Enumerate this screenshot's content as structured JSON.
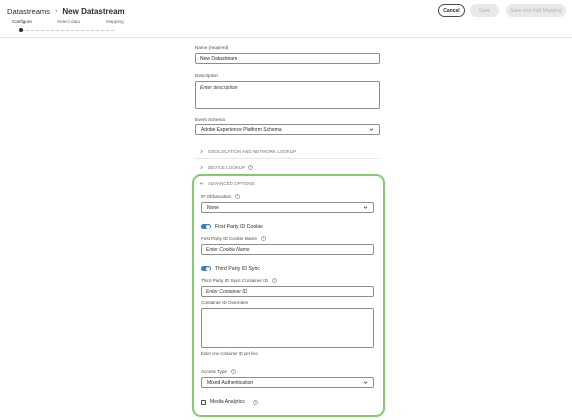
{
  "header": {
    "breadcrumb_root": "Datastreams",
    "breadcrumb_separator": "›",
    "breadcrumb_current": "New Datastream",
    "cancel_label": "Cancel",
    "save_label": "Save",
    "save_and_add_mapping_label": "Save and Add Mapping"
  },
  "steps": {
    "items": [
      {
        "label": "Configure",
        "active": true
      },
      {
        "label": "Select data",
        "active": false
      },
      {
        "label": "Mapping",
        "active": false
      }
    ]
  },
  "form": {
    "name_label": "Name (required)",
    "name_value": "New Datastream",
    "description_label": "Description",
    "description_placeholder": "Enter description",
    "event_schema_label": "Event Schema",
    "event_schema_value": "Adobe Experience Platform Schema",
    "geolocation_label": "GEOLOCATION AND NETWORK LOOKUP",
    "device_lookup_label": "DEVICE LOOKUP",
    "advanced_options_label": "ADVANCED OPTIONS",
    "ip_obfuscation_label": "IP Obfuscation",
    "ip_obfuscation_value": "None",
    "first_party_toggle_label": "First Party ID Cookie",
    "first_party_cookie_name_label": "First Party ID Cookie Name",
    "first_party_cookie_name_placeholder": "Enter Cookie Name",
    "third_party_toggle_label": "Third Party ID Sync",
    "third_party_container_label": "Third Party ID Sync Container ID",
    "third_party_container_placeholder": "Enter Container ID",
    "container_overrides_label": "Container ID Overrides",
    "container_overrides_help": "Enter one container ID per line",
    "access_type_label": "Access Type",
    "access_type_value": "Mixed Authentication",
    "media_analytics_label": "Media Analytics"
  },
  "colors": {
    "highlight_border": "#7fce6a",
    "toggle_on": "#3e78c9"
  }
}
